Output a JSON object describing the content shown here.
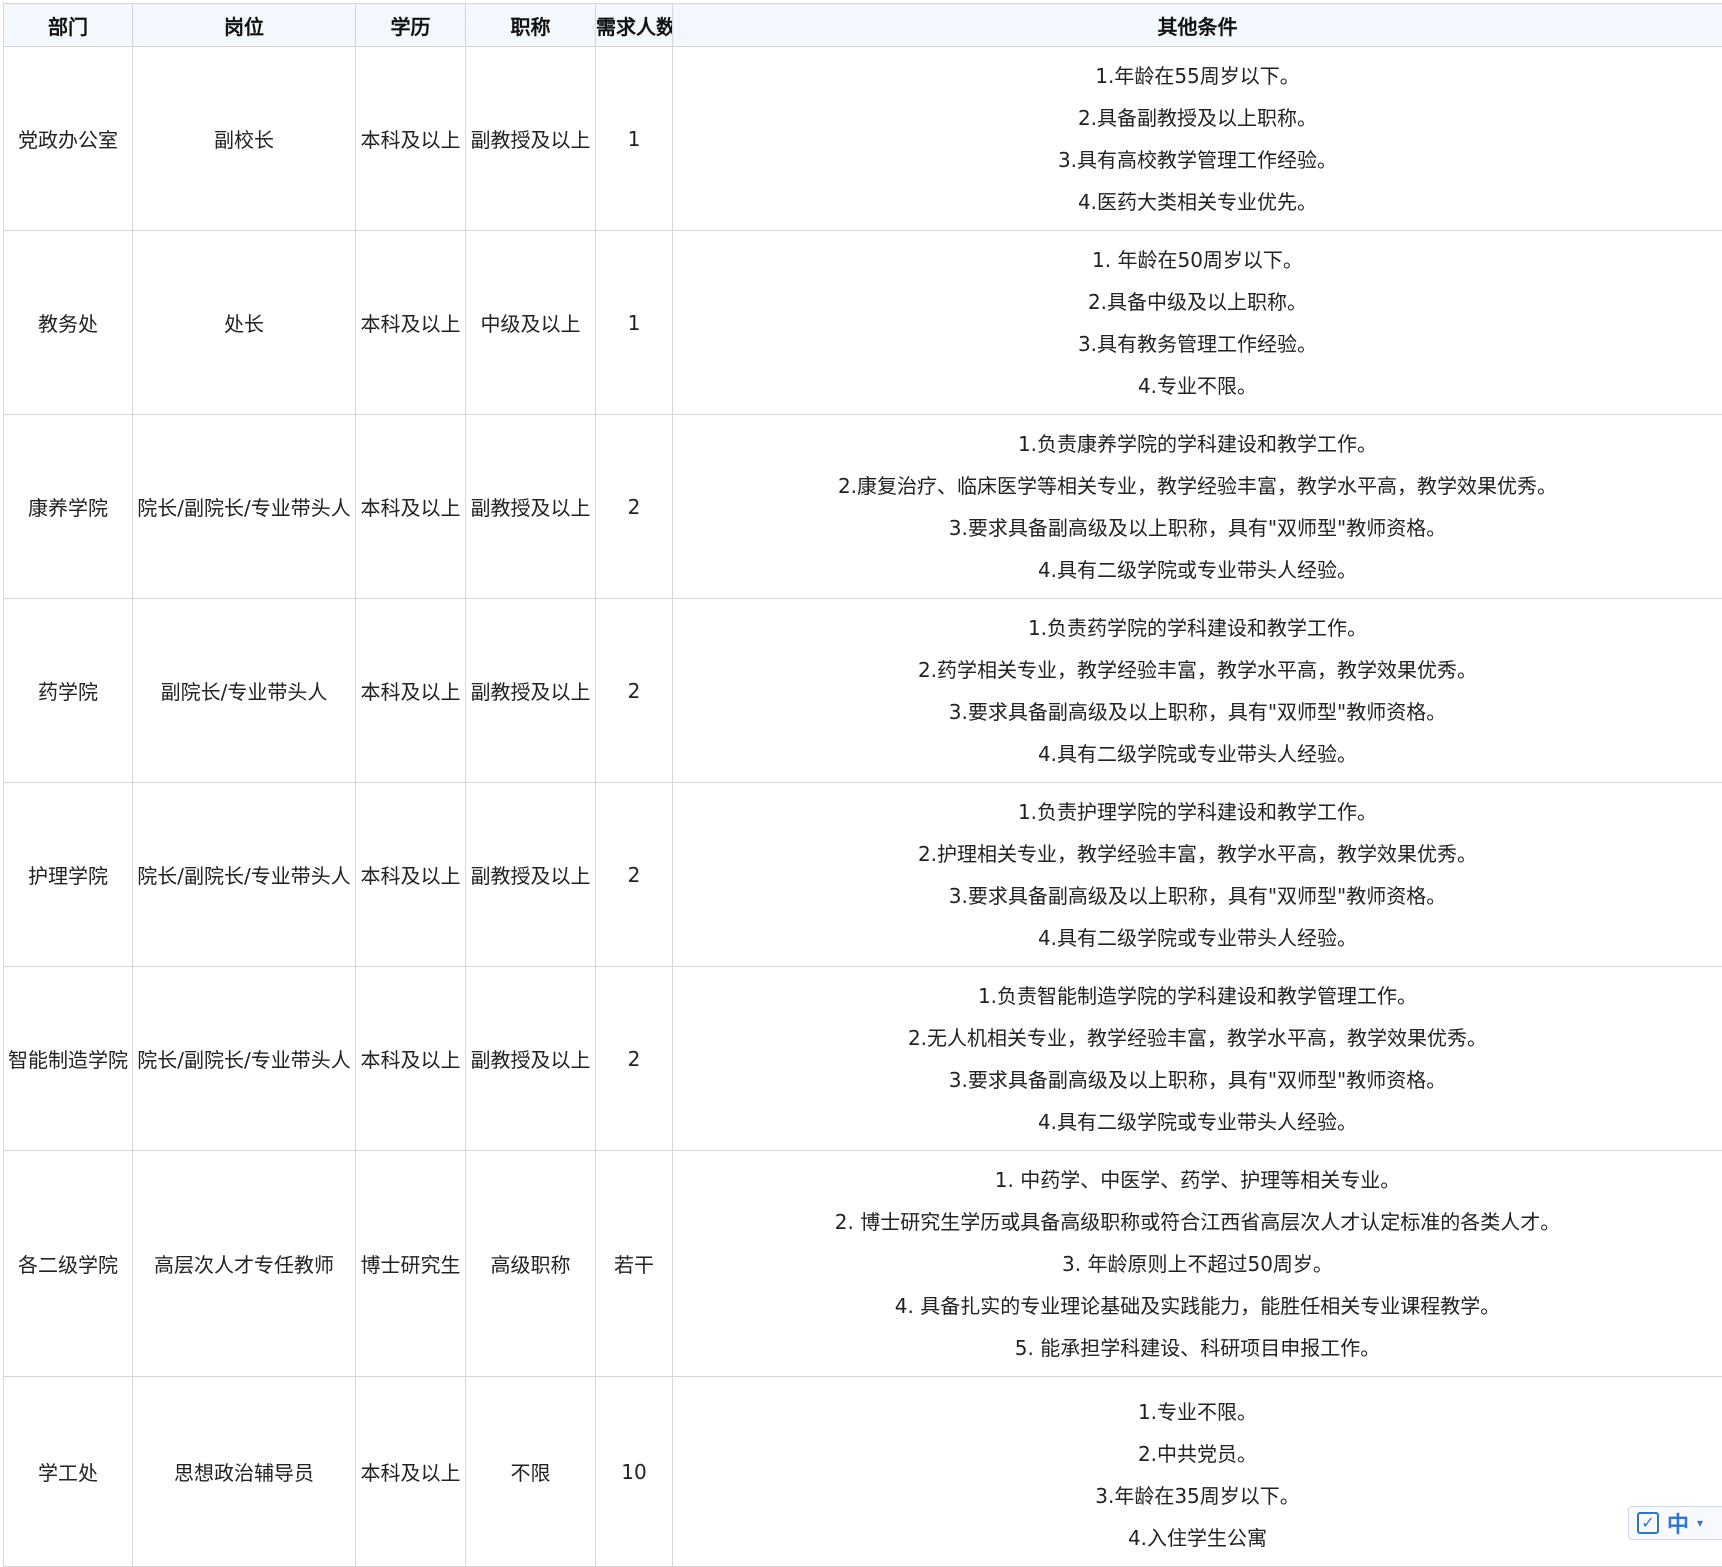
{
  "table": {
    "headers": [
      "部门",
      "岗位",
      "学历",
      "职称",
      "需求人数",
      "其他条件"
    ],
    "rows": [
      {
        "dept": "党政办公室",
        "post": "副校长",
        "edu": "本科及以上",
        "title": "副教授及以上",
        "count": "1",
        "conditions": [
          "1.年龄在55周岁以下。",
          "2.具备副教授及以上职称。",
          "3.具有高校教学管理工作经验。",
          "4.医药大类相关专业优先。"
        ]
      },
      {
        "dept": "教务处",
        "post": "处长",
        "edu": "本科及以上",
        "title": "中级及以上",
        "count": "1",
        "conditions": [
          "1. 年龄在50周岁以下。",
          "2.具备中级及以上职称。",
          "3.具有教务管理工作经验。",
          "4.专业不限。"
        ]
      },
      {
        "dept": "康养学院",
        "post": "院长/副院长/专业带头人",
        "edu": "本科及以上",
        "title": "副教授及以上",
        "count": "2",
        "conditions": [
          "1.负责康养学院的学科建设和教学工作。",
          "2.康复治疗、临床医学等相关专业，教学经验丰富，教学水平高，教学效果优秀。",
          "3.要求具备副高级及以上职称，具有\"双师型\"教师资格。",
          "4.具有二级学院或专业带头人经验。"
        ]
      },
      {
        "dept": "药学院",
        "post": "副院长/专业带头人",
        "edu": "本科及以上",
        "title": "副教授及以上",
        "count": "2",
        "conditions": [
          "1.负责药学院的学科建设和教学工作。",
          "2.药学相关专业，教学经验丰富，教学水平高，教学效果优秀。",
          "3.要求具备副高级及以上职称，具有\"双师型\"教师资格。",
          "4.具有二级学院或专业带头人经验。"
        ]
      },
      {
        "dept": "护理学院",
        "post": "院长/副院长/专业带头人",
        "edu": "本科及以上",
        "title": "副教授及以上",
        "count": "2",
        "conditions": [
          "1.负责护理学院的学科建设和教学工作。",
          "2.护理相关专业，教学经验丰富，教学水平高，教学效果优秀。",
          "3.要求具备副高级及以上职称，具有\"双师型\"教师资格。",
          "4.具有二级学院或专业带头人经验。"
        ]
      },
      {
        "dept": "智能制造学院",
        "post": "院长/副院长/专业带头人",
        "edu": "本科及以上",
        "title": "副教授及以上",
        "count": "2",
        "conditions": [
          "1.负责智能制造学院的学科建设和教学管理工作。",
          "2.无人机相关专业，教学经验丰富，教学水平高，教学效果优秀。",
          "3.要求具备副高级及以上职称，具有\"双师型\"教师资格。",
          "4.具有二级学院或专业带头人经验。"
        ]
      },
      {
        "dept": "各二级学院",
        "post": "高层次人才专任教师",
        "edu": "博士研究生",
        "title": "高级职称",
        "count": "若干",
        "conditions": [
          "1. 中药学、中医学、药学、护理等相关专业。",
          "2. 博士研究生学历或具备高级职称或符合江西省高层次人才认定标准的各类人才。",
          "3. 年龄原则上不超过50周岁。",
          "4. 具备扎实的专业理论基础及实践能力，能胜任相关专业课程教学。",
          "5. 能承担学科建设、科研项目申报工作。"
        ]
      },
      {
        "dept": "学工处",
        "post": "思想政治辅导员",
        "edu": "本科及以上",
        "title": "不限",
        "count": "10",
        "conditions": [
          "1.专业不限。",
          "2.中共党员。",
          "3.年龄在35周岁以下。",
          "4.入住学生公寓"
        ]
      }
    ]
  },
  "ime": {
    "lang": "中",
    "icon": "checkbox-icon",
    "arrow_icon": "chevron-down-icon"
  },
  "colors": {
    "header_bg": "#f2f8fd",
    "border": "#d6d6d6",
    "ime_accent": "#2f74d0"
  }
}
